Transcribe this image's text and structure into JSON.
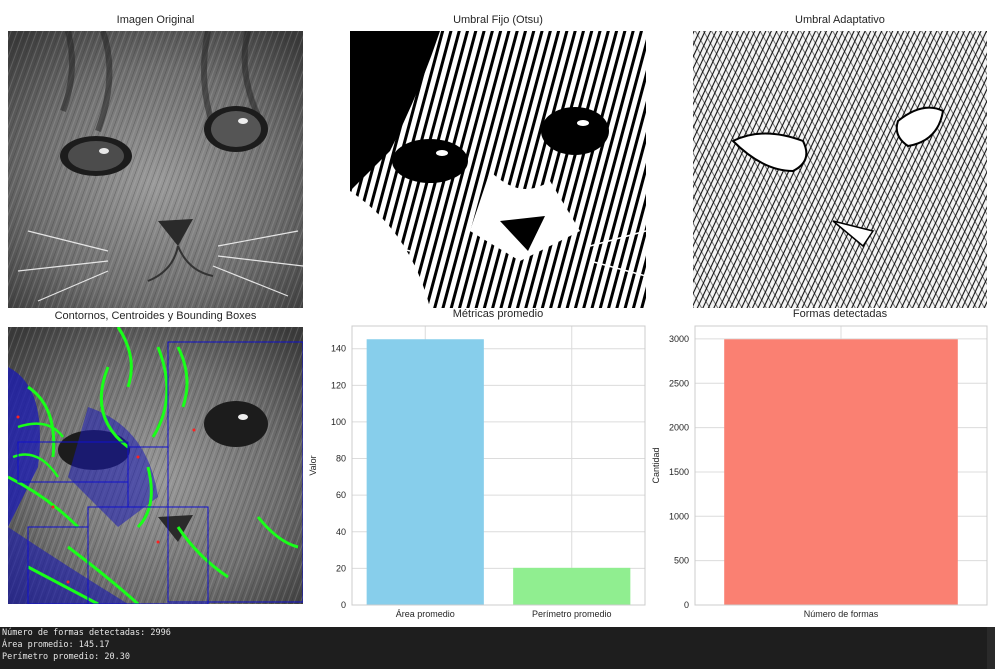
{
  "panels": {
    "original": {
      "title": "Imagen Original"
    },
    "otsu": {
      "title": "Umbral Fijo (Otsu)"
    },
    "adaptive": {
      "title": "Umbral Adaptativo"
    },
    "contours": {
      "title": "Contornos, Centroides y Bounding Boxes"
    }
  },
  "colors": {
    "area_bar": "#87ceeb",
    "perimeter_bar": "#90ee90",
    "shapes_bar": "#fa8072",
    "contour_green": "#00ff00",
    "bbox_blue": "#0000ff",
    "centroid_red": "#ff0000",
    "console_bg": "#1e1e1e"
  },
  "chart_data": [
    {
      "type": "bar",
      "title": "Métricas promedio",
      "categories": [
        "Área promedio",
        "Perímetro promedio"
      ],
      "values": [
        145.17,
        20.3
      ],
      "colors": [
        "#87ceeb",
        "#90ee90"
      ],
      "xlabel": "",
      "ylabel": "Valor",
      "ylim": [
        0,
        152.4
      ],
      "yticks": [
        "0",
        "20",
        "40",
        "60",
        "80",
        "100",
        "120",
        "140"
      ],
      "grid": true
    },
    {
      "type": "bar",
      "title": "Formas detectadas",
      "categories": [
        "Número de formas"
      ],
      "values": [
        2996
      ],
      "colors": [
        "#fa8072"
      ],
      "xlabel": "",
      "ylabel": "Cantidad",
      "ylim": [
        0,
        3145.8
      ],
      "yticks": [
        "0",
        "500",
        "1000",
        "1500",
        "2000",
        "2500",
        "3000"
      ],
      "grid": true
    }
  ],
  "console": {
    "lines": [
      "Número de formas detectadas: 2996",
      "Área promedio: 145.17",
      "Perímetro promedio: 20.30"
    ]
  }
}
